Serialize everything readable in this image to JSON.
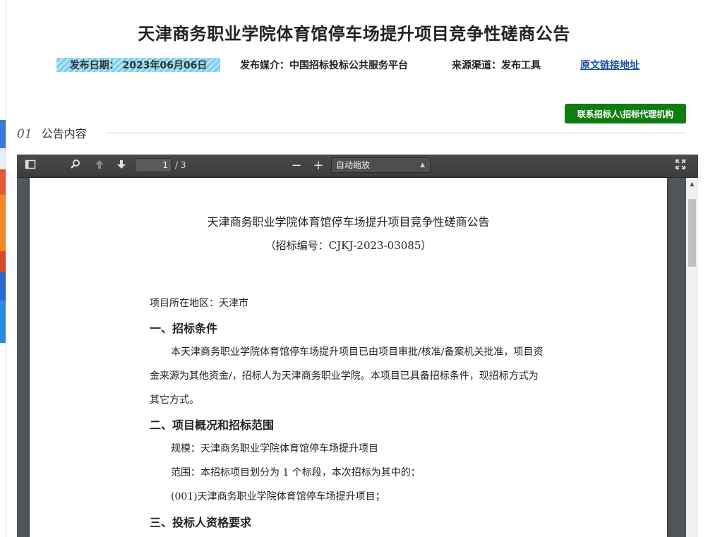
{
  "page": {
    "title": "天津商务职业学院体育馆停车场提升项目竞争性磋商公告"
  },
  "meta": {
    "publish_date": "发布日期： 2023年06月06日",
    "media": "发布媒介：中国招标投标公共服务平台",
    "source": "来源渠道：发布工具",
    "original_link": "原文链接地址"
  },
  "contact_button": "联系招标人\\招标代理机构",
  "section": {
    "number": "01",
    "label": "公告内容"
  },
  "viewer": {
    "current_page": "1",
    "page_count": "/ 3",
    "zoom": "自动缩放",
    "icons": [
      "sidebar-toggle-icon",
      "search-icon",
      "arrow-up-icon",
      "arrow-down-icon",
      "zoom-out-icon",
      "zoom-in-icon",
      "fullscreen-icon"
    ]
  },
  "document": {
    "title": "天津商务职业学院体育馆停车场提升项目竞争性磋商公告",
    "subtitle": "（招标编号：CJKJ-2023-03085）",
    "region": "项目所在地区：天津市",
    "h1": "一、招标条件",
    "p1_line1": "本天津商务职业学院体育馆停车场提升项目已由项目审批/核准/备案机关批准，项目资",
    "p1_line2": "金来源为其他资金/，招标人为天津商务职业学院。本项目已具备招标条件，现招标方式为",
    "p1_line3": "其它方式。",
    "h2": "二、项目概况和招标范围",
    "scale": "规模：天津商务职业学院体育馆停车场提升项目",
    "scope": "范围：本招标项目划分为 1 个标段，本次招标为其中的：",
    "lot": "(001)天津商务职业学院体育馆停车场提升项目；",
    "h3": "三、投标人资格要求"
  }
}
